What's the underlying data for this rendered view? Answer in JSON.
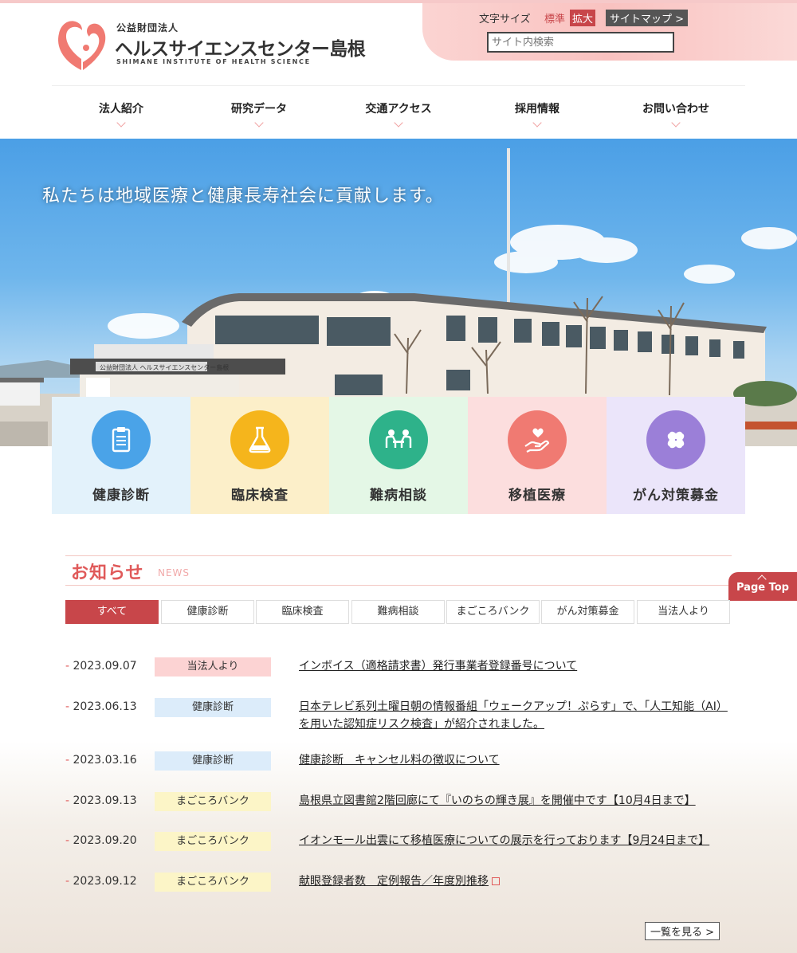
{
  "brand": {
    "pre": "公益財団法人",
    "name": "ヘルスサイエンスセンター島根",
    "english": "SHIMANE INSTITUTE OF HEALTH SCIENCE"
  },
  "utility": {
    "font_size_label": "文字サイズ",
    "standard": "標準",
    "large": "拡大",
    "sitemap": "サイトマップ >",
    "search_placeholder": "サイト内検索"
  },
  "nav": [
    {
      "label": "法人紹介"
    },
    {
      "label": "研究データ"
    },
    {
      "label": "交通アクセス"
    },
    {
      "label": "採用情報"
    },
    {
      "label": "お問い合わせ"
    }
  ],
  "hero": {
    "caption": "私たちは地域医療と健康長寿社会に貢献します。",
    "building_sign": "公益財団法人 ヘルスサイエンスセンター島根"
  },
  "categories": [
    {
      "label": "健康診断",
      "icon": "clipboard-icon",
      "bg": "#e3f2fb",
      "circle": "#4aa3e8"
    },
    {
      "label": "臨床検査",
      "icon": "flask-icon",
      "bg": "#fcefc9",
      "circle": "#f5b51c"
    },
    {
      "label": "難病相談",
      "icon": "consultation-icon",
      "bg": "#e4f7e6",
      "circle": "#2eb28a"
    },
    {
      "label": "移植医療",
      "icon": "heart-hand-icon",
      "bg": "#fcdede",
      "circle": "#f07a72"
    },
    {
      "label": "がん対策募金",
      "icon": "clover-icon",
      "bg": "#ebe5fa",
      "circle": "#9b7fd8"
    }
  ],
  "news": {
    "title": "お知らせ",
    "subtitle": "NEWS",
    "filters": [
      "すべて",
      "健康診断",
      "臨床検査",
      "難病相談",
      "まごころバンク",
      "がん対策募金",
      "当法人より"
    ],
    "items": [
      {
        "date": "2023.09.07",
        "category": "当法人より",
        "cat_color": "#fcd3d3",
        "title": "インボイス（適格請求書）発行事業者登録番号について"
      },
      {
        "date": "2023.06.13",
        "category": "健康診断",
        "cat_color": "#dcecfa",
        "title": "日本テレビ系列土曜日朝の情報番組「ウェークアップ！ぷらす」で、「人工知能（AI）を用いた認知症リスク検査」が紹介されました。"
      },
      {
        "date": "2023.03.16",
        "category": "健康診断",
        "cat_color": "#dcecfa",
        "title": "健康診断　キャンセル料の徴収について"
      },
      {
        "date": "2023.09.13",
        "category": "まごころバンク",
        "cat_color": "#fcf5c7",
        "title": "島根県立図書館2階回廊にて『いのちの輝き展』を開催中です【10月4日まで】"
      },
      {
        "date": "2023.09.20",
        "category": "まごころバンク",
        "cat_color": "#fcf5c7",
        "title": "イオンモール出雲にて移植医療についての展示を行っております【9月24日まで】"
      },
      {
        "date": "2023.09.12",
        "category": "まごころバンク",
        "cat_color": "#fcf5c7",
        "title": "献眼登録者数　定例報告／年度別推移"
      }
    ],
    "more": "一覧を見る >"
  },
  "page_top": "Page Top"
}
